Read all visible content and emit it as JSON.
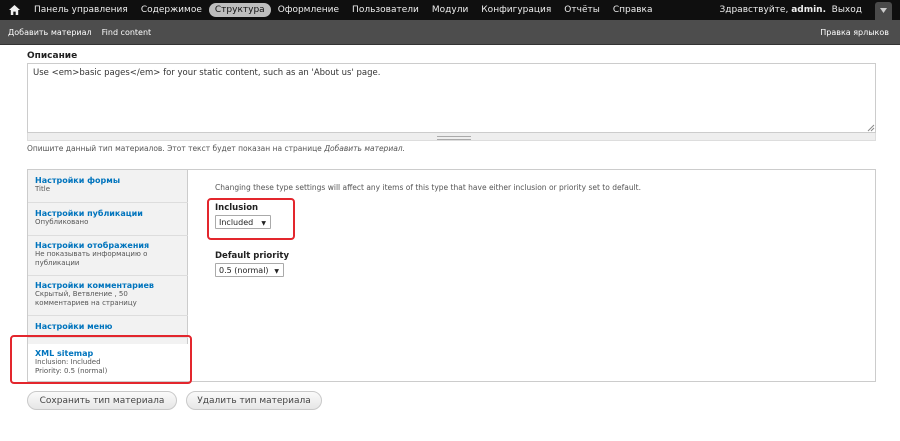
{
  "toolbar": {
    "home_icon": "home-icon",
    "menu": [
      {
        "label": "Панель управления",
        "active": false
      },
      {
        "label": "Содержимое",
        "active": false
      },
      {
        "label": "Структура",
        "active": true
      },
      {
        "label": "Оформление",
        "active": false
      },
      {
        "label": "Пользователи",
        "active": false
      },
      {
        "label": "Модули",
        "active": false
      },
      {
        "label": "Конфигурация",
        "active": false
      },
      {
        "label": "Отчёты",
        "active": false
      },
      {
        "label": "Справка",
        "active": false
      }
    ],
    "greeting": "Здравствуйте,",
    "username": "admin.",
    "logout": "Выход",
    "toggle_icon": "chevron-down-icon"
  },
  "shortcuts": {
    "links": [
      "Добавить материал",
      "Find content"
    ],
    "edit": "Правка ярлыков"
  },
  "description": {
    "label": "Описание",
    "value": "Use <em>basic pages</em> for your static content, such as an 'About us' page.",
    "help_prefix": "Опишите данный тип материалов. Этот текст будет показан на странице",
    "help_link": "Добавить материал."
  },
  "vertical_tabs": [
    {
      "title": "Настройки формы",
      "summary": "Title"
    },
    {
      "title": "Настройки публикации",
      "summary": "Опубликовано"
    },
    {
      "title": "Настройки отображения",
      "summary": "Не показывать информацию о публикации"
    },
    {
      "title": "Настройки комментариев",
      "summary": "Скрытый, Ветвление , 50 комментариев на страницу"
    },
    {
      "title": "Настройки меню",
      "summary": ""
    },
    {
      "title": "XML sitemap",
      "summary": "Inclusion: Included\nPriority: 0.5 (normal)"
    }
  ],
  "xml_sitemap": {
    "notice": "Changing these type settings will affect any items of this type that have either inclusion or priority set to default.",
    "inclusion_label": "Inclusion",
    "inclusion_value": "Included",
    "priority_label": "Default priority",
    "priority_value": "0.5 (normal)"
  },
  "actions": {
    "save": "Сохранить тип материала",
    "delete": "Удалить тип материала"
  },
  "colors": {
    "toolbar_bg": "#0f0f0f",
    "shortcuts_bg": "#4d4d4d",
    "link_blue": "#0074bd",
    "highlight_red": "#e3262d"
  }
}
